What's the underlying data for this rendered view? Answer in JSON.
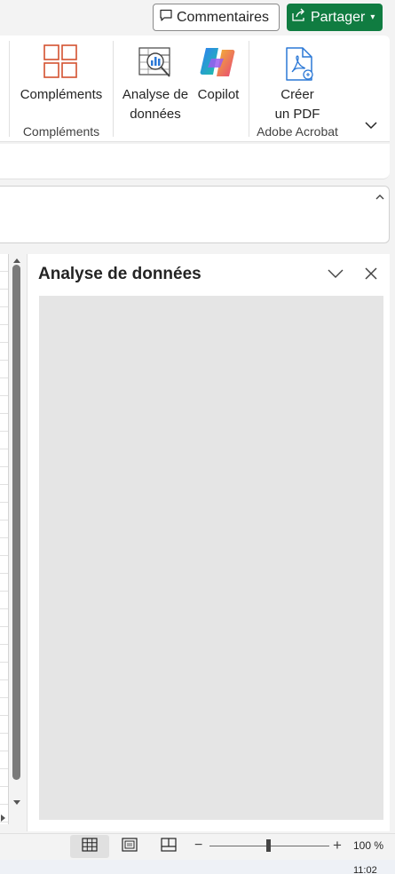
{
  "header": {
    "comments_label": "Commentaires",
    "share_label": "Partager"
  },
  "ribbon": {
    "addins_button_label": "Compléments",
    "addins_group_label": "Compléments",
    "analyze_label_line1": "Analyse de",
    "analyze_label_line2": "données",
    "copilot_label": "Copilot",
    "create_pdf_line1": "Créer",
    "create_pdf_line2": "un PDF",
    "acrobat_group_label": "Adobe Acrobat"
  },
  "task_pane": {
    "title": "Analyse de données"
  },
  "statusbar": {
    "zoom_label": "100 %",
    "zoom_minus": "−",
    "zoom_plus": "+"
  },
  "taskbar": {
    "clock": "11:02"
  },
  "colors": {
    "share_green": "#107c41",
    "addins_orange": "#d35230",
    "acrobat_blue": "#2b78d6"
  }
}
